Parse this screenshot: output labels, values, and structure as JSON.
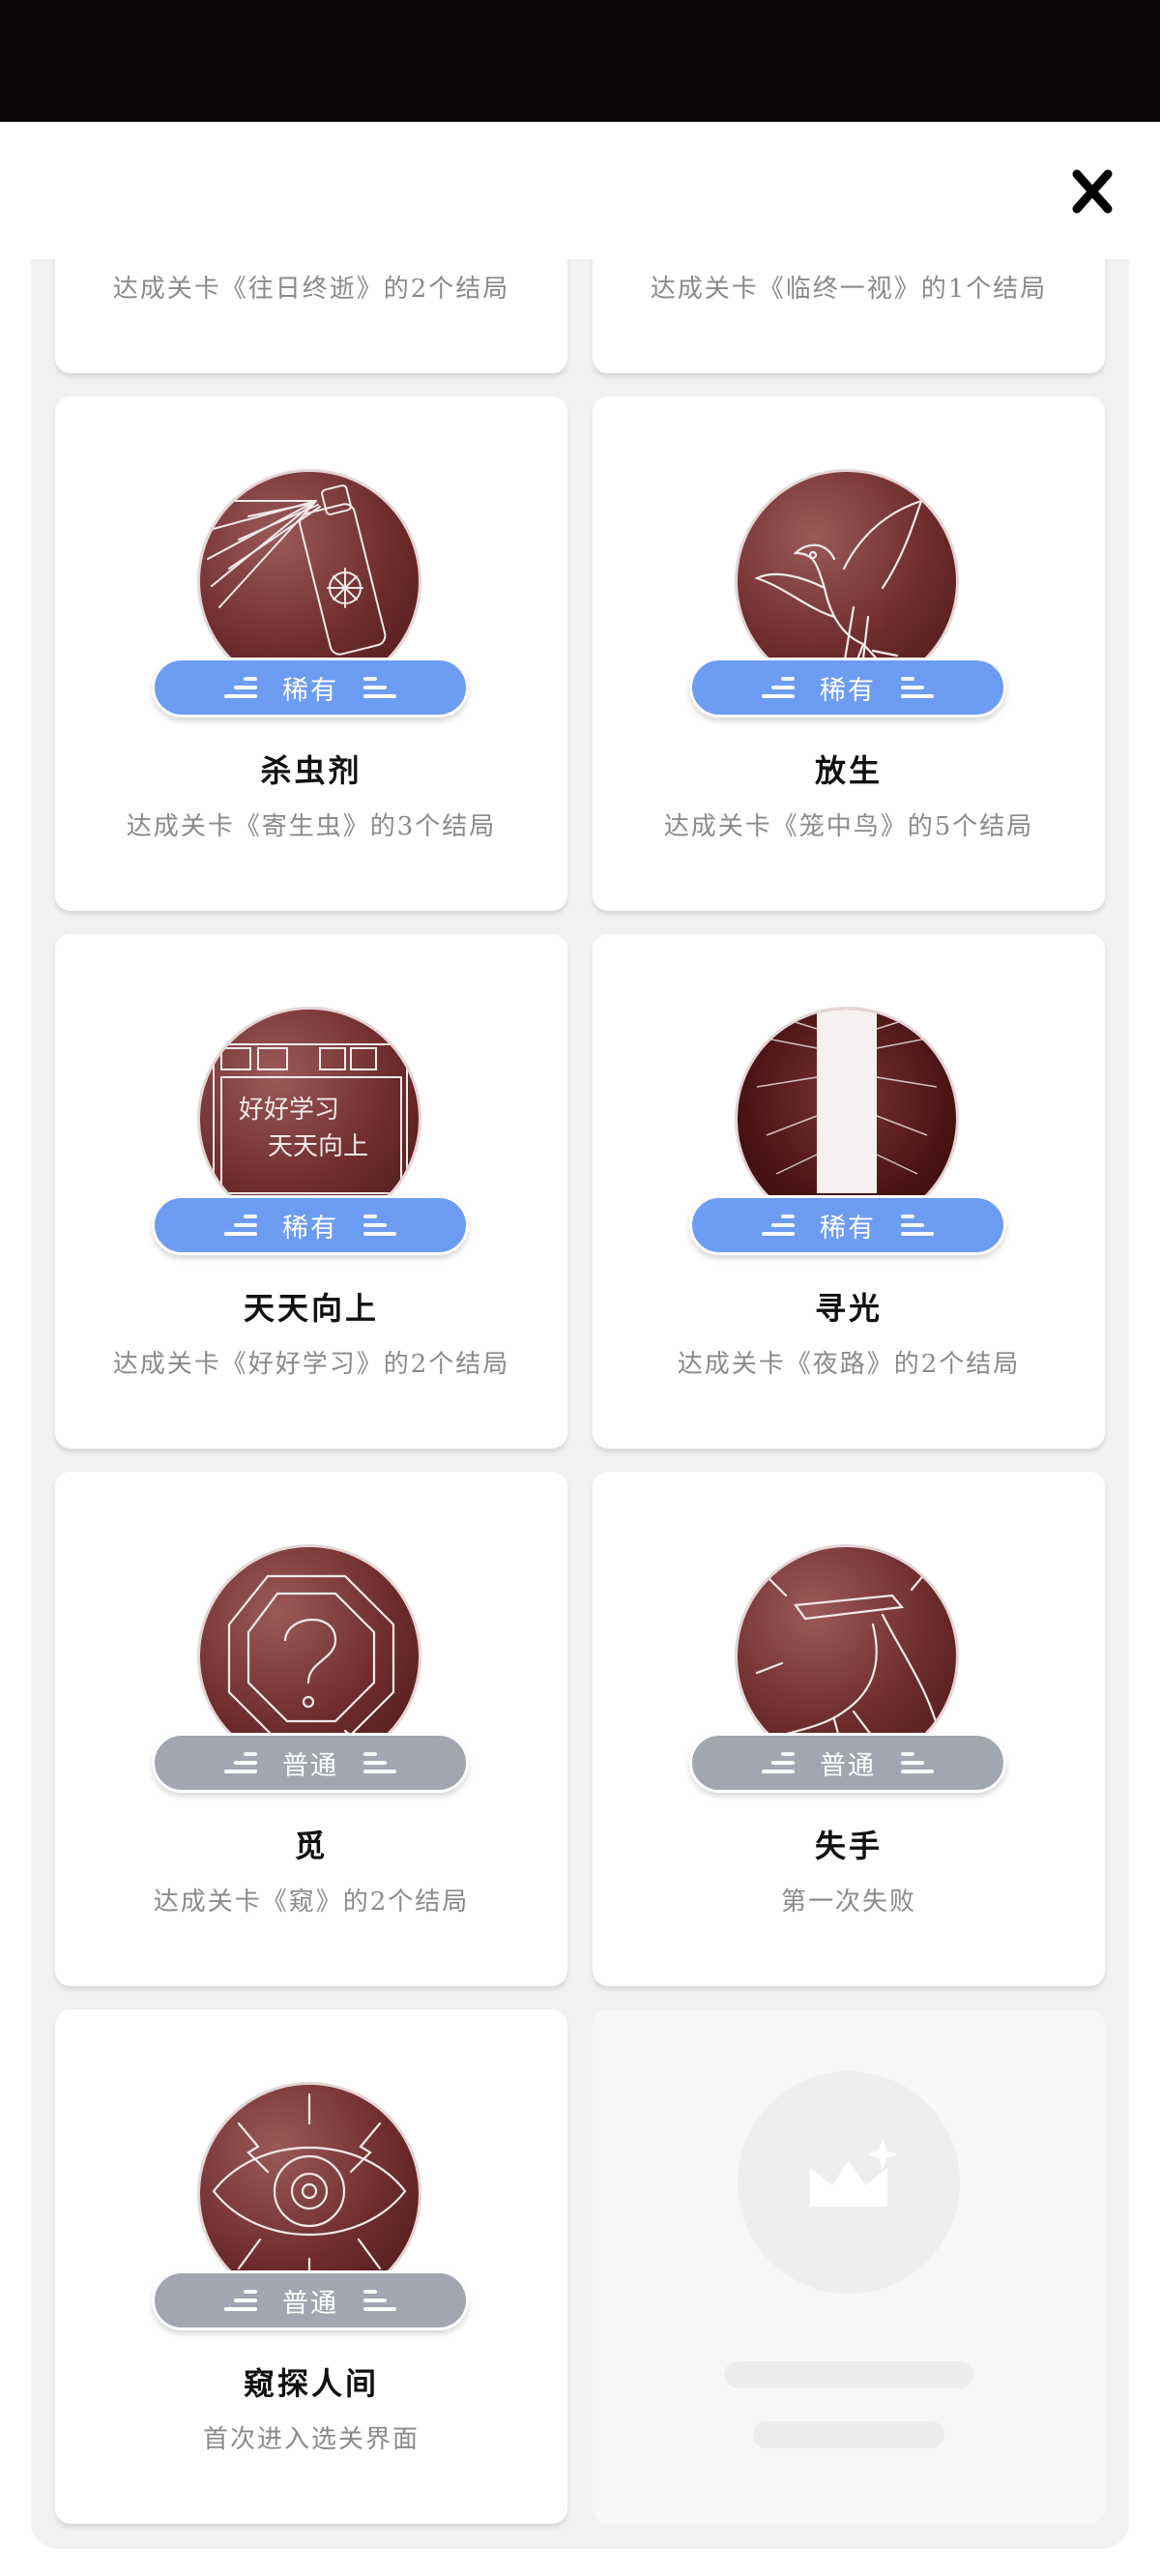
{
  "colors": {
    "rare": "#6d9cf3",
    "common": "#a2a6b0",
    "medal": "#6e2c2c"
  },
  "top_cards": [
    {
      "desc": "达成关卡《往日终逝》的2个结局"
    },
    {
      "desc": "达成关卡《临终一视》的1个结局"
    }
  ],
  "cards": [
    {
      "title": "杀虫剂",
      "rarity": "稀有",
      "desc": "达成关卡《寄生虫》的3个结局",
      "icon": "spray-can-icon"
    },
    {
      "title": "放生",
      "rarity": "稀有",
      "desc": "达成关卡《笼中鸟》的5个结局",
      "icon": "dove-icon"
    },
    {
      "title": "天天向上",
      "rarity": "稀有",
      "desc": "达成关卡《好好学习》的2个结局",
      "icon": "blackboard-icon",
      "board_text_1": "好好学习",
      "board_text_2": "天天向上"
    },
    {
      "title": "寻光",
      "rarity": "稀有",
      "desc": "达成关卡《夜路》的2个结局",
      "icon": "light-beam-icon"
    },
    {
      "title": "觅",
      "rarity": "普通",
      "desc": "达成关卡《窥》的2个结局",
      "icon": "magnifier-question-icon"
    },
    {
      "title": "失手",
      "rarity": "普通",
      "desc": "第一次失败",
      "icon": "falling-hand-icon"
    },
    {
      "title": "窥探人间",
      "rarity": "普通",
      "desc": "首次进入选关界面",
      "icon": "eye-icon"
    }
  ],
  "placeholder": {
    "icon": "crown-sparkle-icon"
  }
}
